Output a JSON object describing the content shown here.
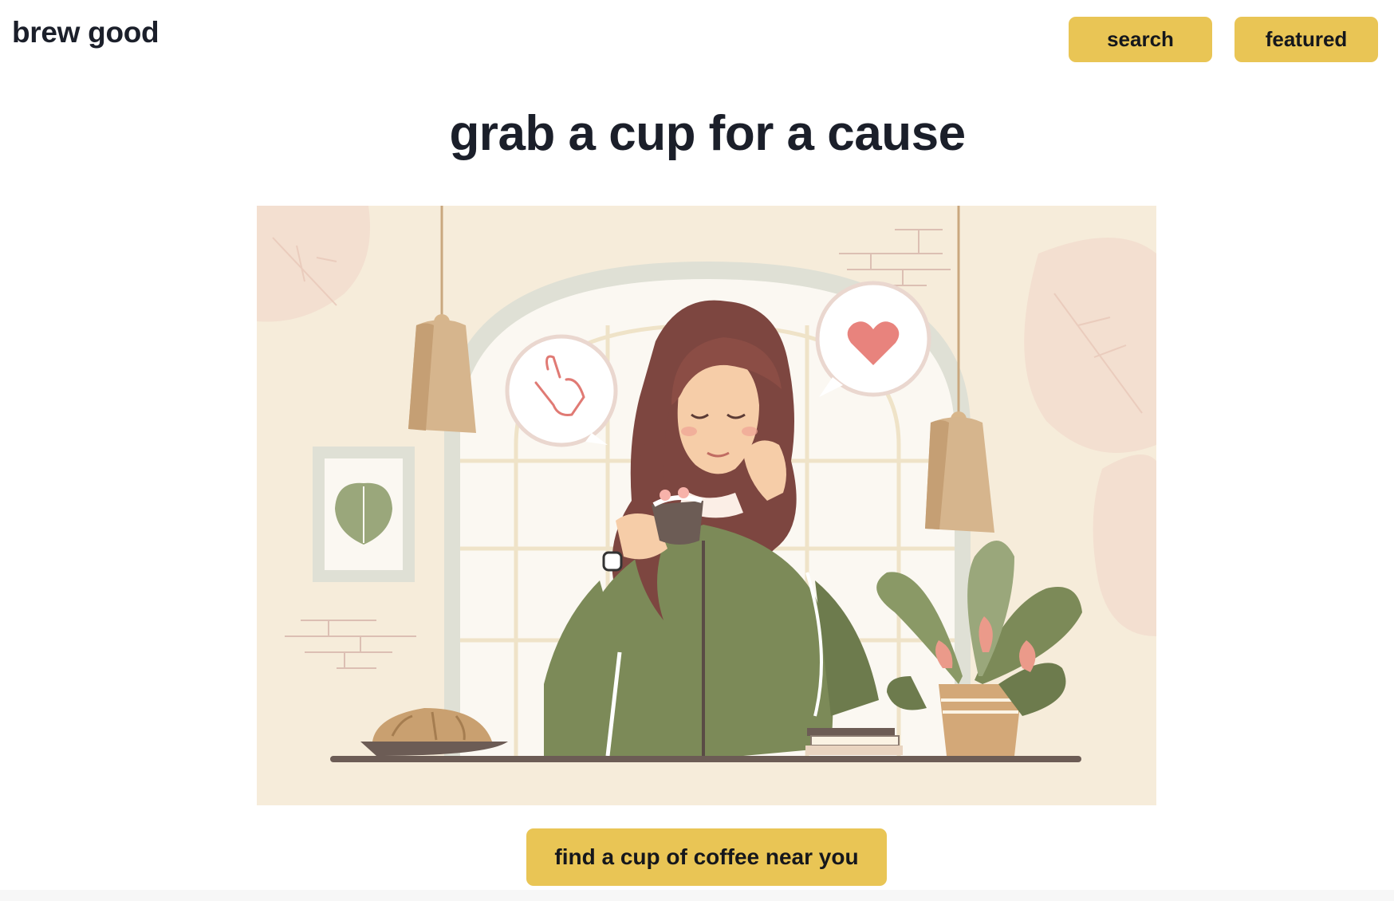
{
  "header": {
    "brand": "brew good",
    "nav": [
      {
        "label": "search"
      },
      {
        "label": "featured"
      }
    ]
  },
  "hero": {
    "title": "grab a cup for a cause",
    "illustration_icon": "woman-drinking-coffee-illustration",
    "cta_label": "find a cup of coffee near you"
  },
  "colors": {
    "accent": "#e9c555",
    "text": "#1b1f2a",
    "illustration_bg": "#f6ecda"
  }
}
